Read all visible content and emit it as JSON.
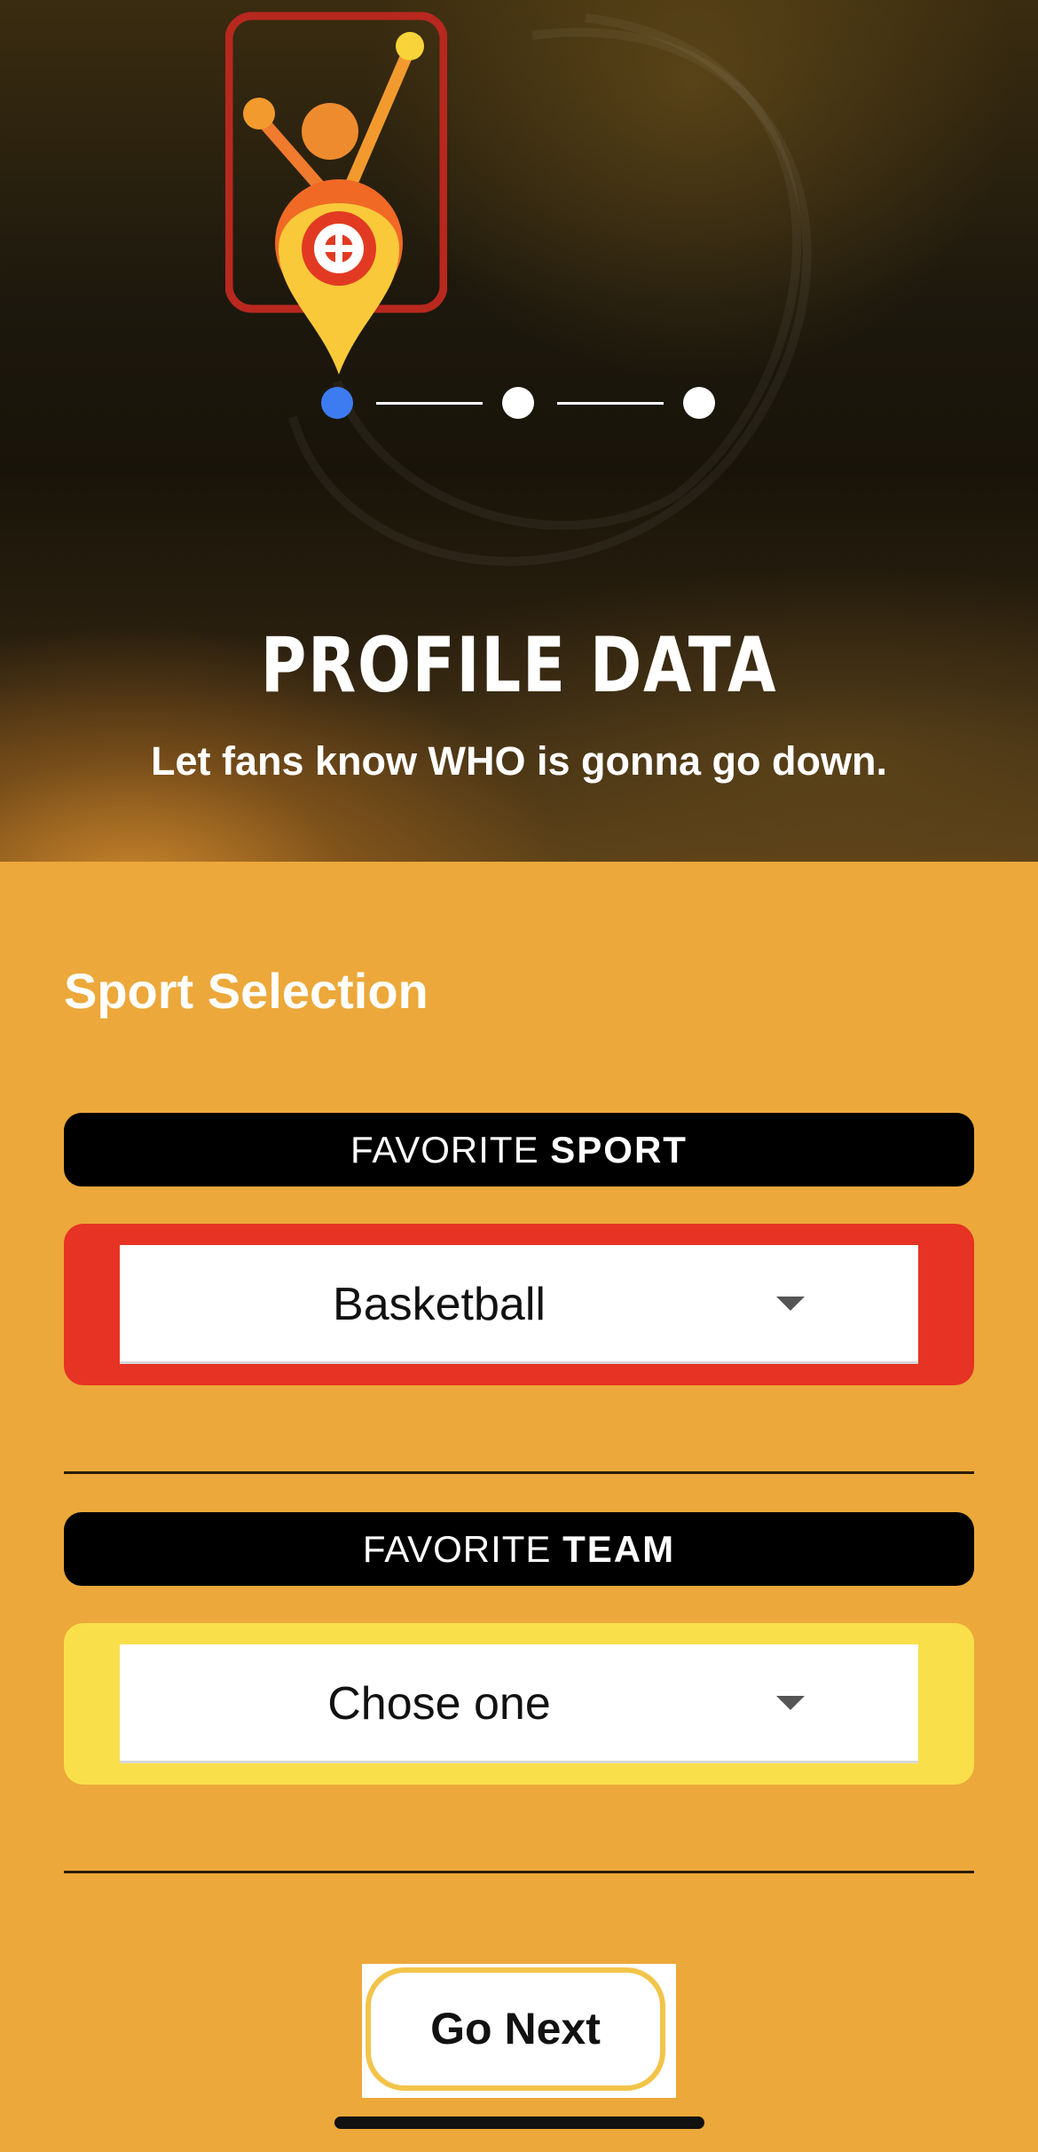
{
  "hero": {
    "title": "PROFILE DATA",
    "subtitle": "Let fans know WHO is gonna go down.",
    "logo_icon": "sports-fan-location-pin-logo"
  },
  "stepper": {
    "total_steps": 3,
    "current_step": 1,
    "active_color": "#3d7bf0"
  },
  "form": {
    "section_title": "Sport Selection",
    "sport": {
      "label_prefix": "FAVORITE",
      "label_bold": "SPORT",
      "value": "Basketball",
      "frame_color": "#e63324",
      "caret_icon": "caret-down-icon"
    },
    "team": {
      "label_prefix": "FAVORITE",
      "label_bold": "TEAM",
      "value": "Chose one",
      "frame_color": "#f9e04b",
      "caret_icon": "caret-down-icon"
    },
    "next_label": "Go Next"
  },
  "colors": {
    "background": "#eca83a",
    "label_bar": "#000000",
    "button_border": "#f2c44a"
  }
}
